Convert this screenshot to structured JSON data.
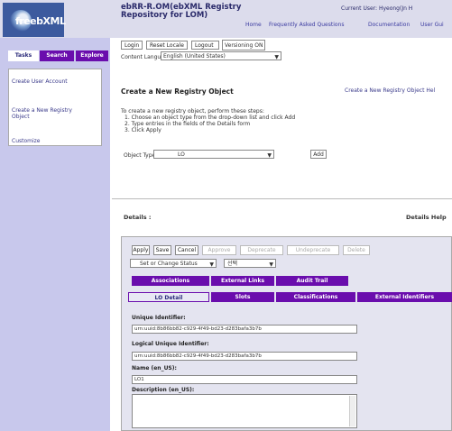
{
  "header": {
    "logo_main": "freebXML",
    "logo_prefix": "free",
    "logo_suffix": "bXML",
    "title": "ebRR-R.OM(ebXML Registry Repository for LOM)",
    "current_user": "Current User: Hyeong(Jn H",
    "nav": [
      "Home",
      "Frequently Asked Questions",
      "Documentation",
      "User Gui"
    ]
  },
  "toolbar": {
    "login": "Login",
    "reset_locale": "Reset Locale",
    "logout": "Logout",
    "versioning": "Versioning ON",
    "content_language_label": "Content Language:",
    "content_language_value": "English (United States)"
  },
  "sidebar": {
    "tabs": [
      "Tasks",
      "Search",
      "Explore"
    ],
    "links": [
      "Create User Account",
      "Create a New Registry Object",
      "Customize"
    ]
  },
  "main": {
    "create_title": "Create a New Registry Object",
    "create_help": "Create a New Registry Object Hel",
    "instructions_intro": "To create a new registry object, perform these steps:",
    "steps": [
      "1.  Choose an object type from the drop-down list and click Add",
      "2.  Type entries in the fields of the Details form",
      "3.  Click Apply"
    ],
    "object_type_label": "Object Type:",
    "object_type_value": "LO",
    "add_label": "Add"
  },
  "details": {
    "label": "Details :",
    "help": "Details Help",
    "actions": [
      "Apply",
      "Save",
      "Cancel",
      "Approve",
      "Deprecate",
      "Undeprecate",
      "Delete"
    ],
    "status_select": "Set or Change Status",
    "status_select2": "선택",
    "tabs_row1": [
      "Associations",
      "External Links",
      "Audit Trail"
    ],
    "tabs_row2": [
      "LO Detail",
      "Slots",
      "Classifications",
      "External Identifiers"
    ],
    "fields": {
      "unique_id_label": "Unique Identifier:",
      "unique_id_value": "urn:uuid:8b86bb82-c929-4f49-bd23-d283bafa3b7b",
      "logical_id_label": "Logical Unique Identifier:",
      "logical_id_value": "urn:uuid:8b86bb82-c929-4f49-bd23-d283bafa3b7b",
      "name_label": "Name (en_US):",
      "name_value": "LO1",
      "desc_label": "Description (en_US):"
    }
  }
}
